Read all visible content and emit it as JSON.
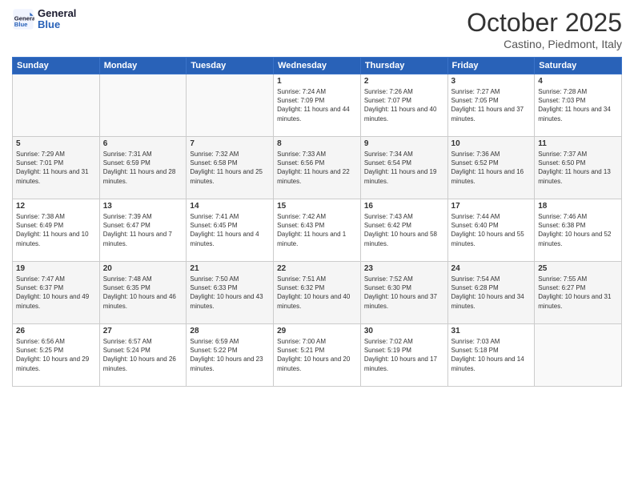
{
  "header": {
    "logo_line1": "General",
    "logo_line2": "Blue",
    "month": "October 2025",
    "location": "Castino, Piedmont, Italy"
  },
  "weekdays": [
    "Sunday",
    "Monday",
    "Tuesday",
    "Wednesday",
    "Thursday",
    "Friday",
    "Saturday"
  ],
  "weeks": [
    [
      {
        "day": "",
        "sunrise": "",
        "sunset": "",
        "daylight": ""
      },
      {
        "day": "",
        "sunrise": "",
        "sunset": "",
        "daylight": ""
      },
      {
        "day": "",
        "sunrise": "",
        "sunset": "",
        "daylight": ""
      },
      {
        "day": "1",
        "sunrise": "Sunrise: 7:24 AM",
        "sunset": "Sunset: 7:09 PM",
        "daylight": "Daylight: 11 hours and 44 minutes."
      },
      {
        "day": "2",
        "sunrise": "Sunrise: 7:26 AM",
        "sunset": "Sunset: 7:07 PM",
        "daylight": "Daylight: 11 hours and 40 minutes."
      },
      {
        "day": "3",
        "sunrise": "Sunrise: 7:27 AM",
        "sunset": "Sunset: 7:05 PM",
        "daylight": "Daylight: 11 hours and 37 minutes."
      },
      {
        "day": "4",
        "sunrise": "Sunrise: 7:28 AM",
        "sunset": "Sunset: 7:03 PM",
        "daylight": "Daylight: 11 hours and 34 minutes."
      }
    ],
    [
      {
        "day": "5",
        "sunrise": "Sunrise: 7:29 AM",
        "sunset": "Sunset: 7:01 PM",
        "daylight": "Daylight: 11 hours and 31 minutes."
      },
      {
        "day": "6",
        "sunrise": "Sunrise: 7:31 AM",
        "sunset": "Sunset: 6:59 PM",
        "daylight": "Daylight: 11 hours and 28 minutes."
      },
      {
        "day": "7",
        "sunrise": "Sunrise: 7:32 AM",
        "sunset": "Sunset: 6:58 PM",
        "daylight": "Daylight: 11 hours and 25 minutes."
      },
      {
        "day": "8",
        "sunrise": "Sunrise: 7:33 AM",
        "sunset": "Sunset: 6:56 PM",
        "daylight": "Daylight: 11 hours and 22 minutes."
      },
      {
        "day": "9",
        "sunrise": "Sunrise: 7:34 AM",
        "sunset": "Sunset: 6:54 PM",
        "daylight": "Daylight: 11 hours and 19 minutes."
      },
      {
        "day": "10",
        "sunrise": "Sunrise: 7:36 AM",
        "sunset": "Sunset: 6:52 PM",
        "daylight": "Daylight: 11 hours and 16 minutes."
      },
      {
        "day": "11",
        "sunrise": "Sunrise: 7:37 AM",
        "sunset": "Sunset: 6:50 PM",
        "daylight": "Daylight: 11 hours and 13 minutes."
      }
    ],
    [
      {
        "day": "12",
        "sunrise": "Sunrise: 7:38 AM",
        "sunset": "Sunset: 6:49 PM",
        "daylight": "Daylight: 11 hours and 10 minutes."
      },
      {
        "day": "13",
        "sunrise": "Sunrise: 7:39 AM",
        "sunset": "Sunset: 6:47 PM",
        "daylight": "Daylight: 11 hours and 7 minutes."
      },
      {
        "day": "14",
        "sunrise": "Sunrise: 7:41 AM",
        "sunset": "Sunset: 6:45 PM",
        "daylight": "Daylight: 11 hours and 4 minutes."
      },
      {
        "day": "15",
        "sunrise": "Sunrise: 7:42 AM",
        "sunset": "Sunset: 6:43 PM",
        "daylight": "Daylight: 11 hours and 1 minute."
      },
      {
        "day": "16",
        "sunrise": "Sunrise: 7:43 AM",
        "sunset": "Sunset: 6:42 PM",
        "daylight": "Daylight: 10 hours and 58 minutes."
      },
      {
        "day": "17",
        "sunrise": "Sunrise: 7:44 AM",
        "sunset": "Sunset: 6:40 PM",
        "daylight": "Daylight: 10 hours and 55 minutes."
      },
      {
        "day": "18",
        "sunrise": "Sunrise: 7:46 AM",
        "sunset": "Sunset: 6:38 PM",
        "daylight": "Daylight: 10 hours and 52 minutes."
      }
    ],
    [
      {
        "day": "19",
        "sunrise": "Sunrise: 7:47 AM",
        "sunset": "Sunset: 6:37 PM",
        "daylight": "Daylight: 10 hours and 49 minutes."
      },
      {
        "day": "20",
        "sunrise": "Sunrise: 7:48 AM",
        "sunset": "Sunset: 6:35 PM",
        "daylight": "Daylight: 10 hours and 46 minutes."
      },
      {
        "day": "21",
        "sunrise": "Sunrise: 7:50 AM",
        "sunset": "Sunset: 6:33 PM",
        "daylight": "Daylight: 10 hours and 43 minutes."
      },
      {
        "day": "22",
        "sunrise": "Sunrise: 7:51 AM",
        "sunset": "Sunset: 6:32 PM",
        "daylight": "Daylight: 10 hours and 40 minutes."
      },
      {
        "day": "23",
        "sunrise": "Sunrise: 7:52 AM",
        "sunset": "Sunset: 6:30 PM",
        "daylight": "Daylight: 10 hours and 37 minutes."
      },
      {
        "day": "24",
        "sunrise": "Sunrise: 7:54 AM",
        "sunset": "Sunset: 6:28 PM",
        "daylight": "Daylight: 10 hours and 34 minutes."
      },
      {
        "day": "25",
        "sunrise": "Sunrise: 7:55 AM",
        "sunset": "Sunset: 6:27 PM",
        "daylight": "Daylight: 10 hours and 31 minutes."
      }
    ],
    [
      {
        "day": "26",
        "sunrise": "Sunrise: 6:56 AM",
        "sunset": "Sunset: 5:25 PM",
        "daylight": "Daylight: 10 hours and 29 minutes."
      },
      {
        "day": "27",
        "sunrise": "Sunrise: 6:57 AM",
        "sunset": "Sunset: 5:24 PM",
        "daylight": "Daylight: 10 hours and 26 minutes."
      },
      {
        "day": "28",
        "sunrise": "Sunrise: 6:59 AM",
        "sunset": "Sunset: 5:22 PM",
        "daylight": "Daylight: 10 hours and 23 minutes."
      },
      {
        "day": "29",
        "sunrise": "Sunrise: 7:00 AM",
        "sunset": "Sunset: 5:21 PM",
        "daylight": "Daylight: 10 hours and 20 minutes."
      },
      {
        "day": "30",
        "sunrise": "Sunrise: 7:02 AM",
        "sunset": "Sunset: 5:19 PM",
        "daylight": "Daylight: 10 hours and 17 minutes."
      },
      {
        "day": "31",
        "sunrise": "Sunrise: 7:03 AM",
        "sunset": "Sunset: 5:18 PM",
        "daylight": "Daylight: 10 hours and 14 minutes."
      },
      {
        "day": "",
        "sunrise": "",
        "sunset": "",
        "daylight": ""
      }
    ]
  ]
}
